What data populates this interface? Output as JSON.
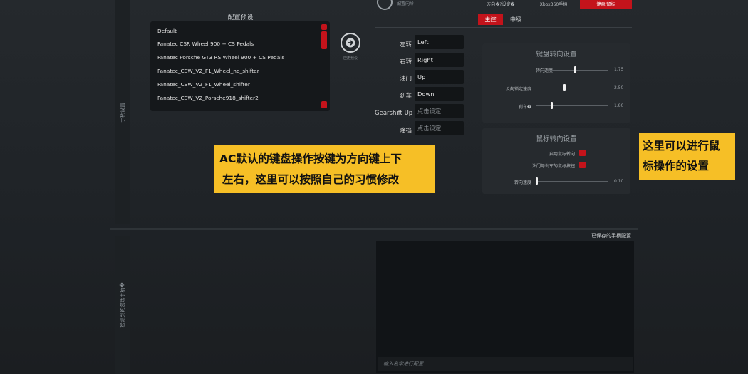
{
  "top_nav": {
    "logo_text": "配置向导",
    "tabs": [
      {
        "label": "方向�?设定�",
        "active": false
      },
      {
        "label": "Xbox360手柄",
        "active": false
      },
      {
        "label": "键盘/鼠标",
        "active": true
      }
    ]
  },
  "sub_tabs": [
    {
      "label": "主控",
      "active": true
    },
    {
      "label": "中级",
      "active": false
    }
  ],
  "left_strips": {
    "top_label": "手柄设置",
    "bottom_label": "检测到的游戏手柄�"
  },
  "presets": {
    "title": "配置预设",
    "items": [
      "Default",
      "Fanatec CSR Wheel 900 + CS Pedals",
      "Fanatec Porsche GT3 RS Wheel 900 + CS Pedals",
      "Fanatec_CSW_V2_F1_Wheel_no_shifter",
      "Fanatec_CSW_V2_F1_Wheel_shifter",
      "Fanatec_CSW_V2_Porsche918_shifter2"
    ],
    "apply_label": "应用预设"
  },
  "key_bindings": [
    {
      "label": "左转",
      "value": "Left",
      "placeholder": false
    },
    {
      "label": "右转",
      "value": "Right",
      "placeholder": false
    },
    {
      "label": "油门",
      "value": "Up",
      "placeholder": false
    },
    {
      "label": "刹车",
      "value": "Down",
      "placeholder": false
    },
    {
      "label": "Gearshift Up",
      "value": "点击设定",
      "placeholder": true
    },
    {
      "label": "降挡",
      "value": "点击设定",
      "placeholder": true
    }
  ],
  "keyboard_steer": {
    "title": "键盘转向设置",
    "sliders": [
      {
        "label": "转向速度",
        "value": "1.75",
        "fraction": 0.55
      },
      {
        "label": "反向锁定速度",
        "value": "2.50",
        "fraction": 0.35
      },
      {
        "label": "刹车�",
        "value": "1.80",
        "fraction": 0.12
      }
    ]
  },
  "mouse_steer": {
    "title": "鼠标转向设置",
    "checks": [
      {
        "label": "启用鼠标转向"
      },
      {
        "label": "油门与刹车的鼠标按钮"
      }
    ],
    "slider": {
      "label": "转向速度",
      "value": "0.10",
      "fraction": 0.0
    }
  },
  "annotations": {
    "keyboard_line1": "AC默认的键盘操作按键为方向键上下",
    "keyboard_line2": "左右，这里可以按照自己的习惯修改",
    "mouse_line1": "这里可以进行鼠",
    "mouse_line2": "标操作的设置"
  },
  "saved": {
    "label": "已保存的手柄配置",
    "input_placeholder": "输入名字进行配置"
  },
  "colors": {
    "accent": "#c3131b",
    "annotation": "#f6bf26"
  }
}
